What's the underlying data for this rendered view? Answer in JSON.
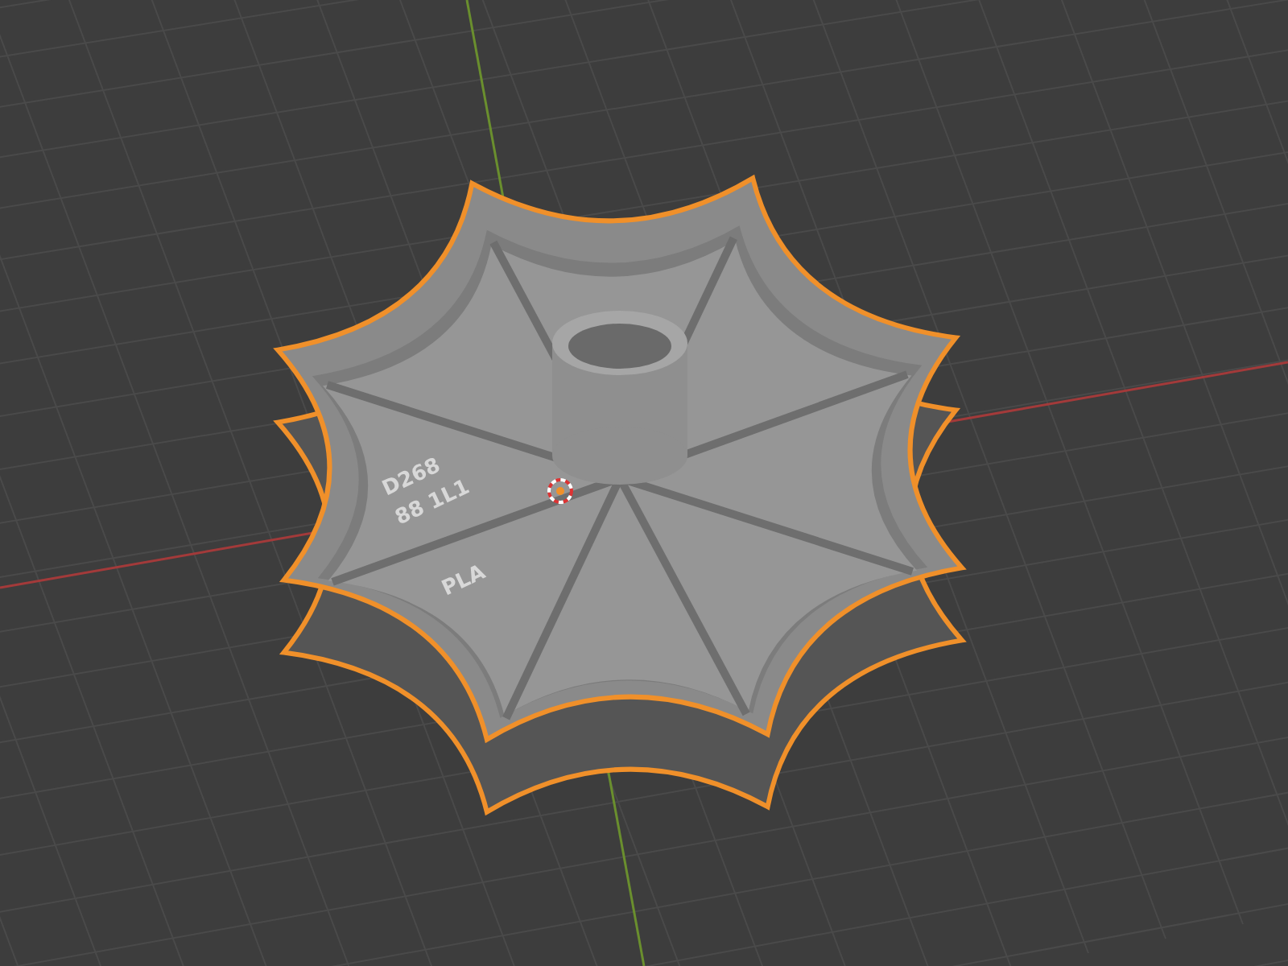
{
  "viewport": {
    "object": {
      "selected": true,
      "markings": [
        {
          "text": "D268"
        },
        {
          "text": "88 1L1"
        },
        {
          "text": "PLA"
        }
      ]
    }
  }
}
